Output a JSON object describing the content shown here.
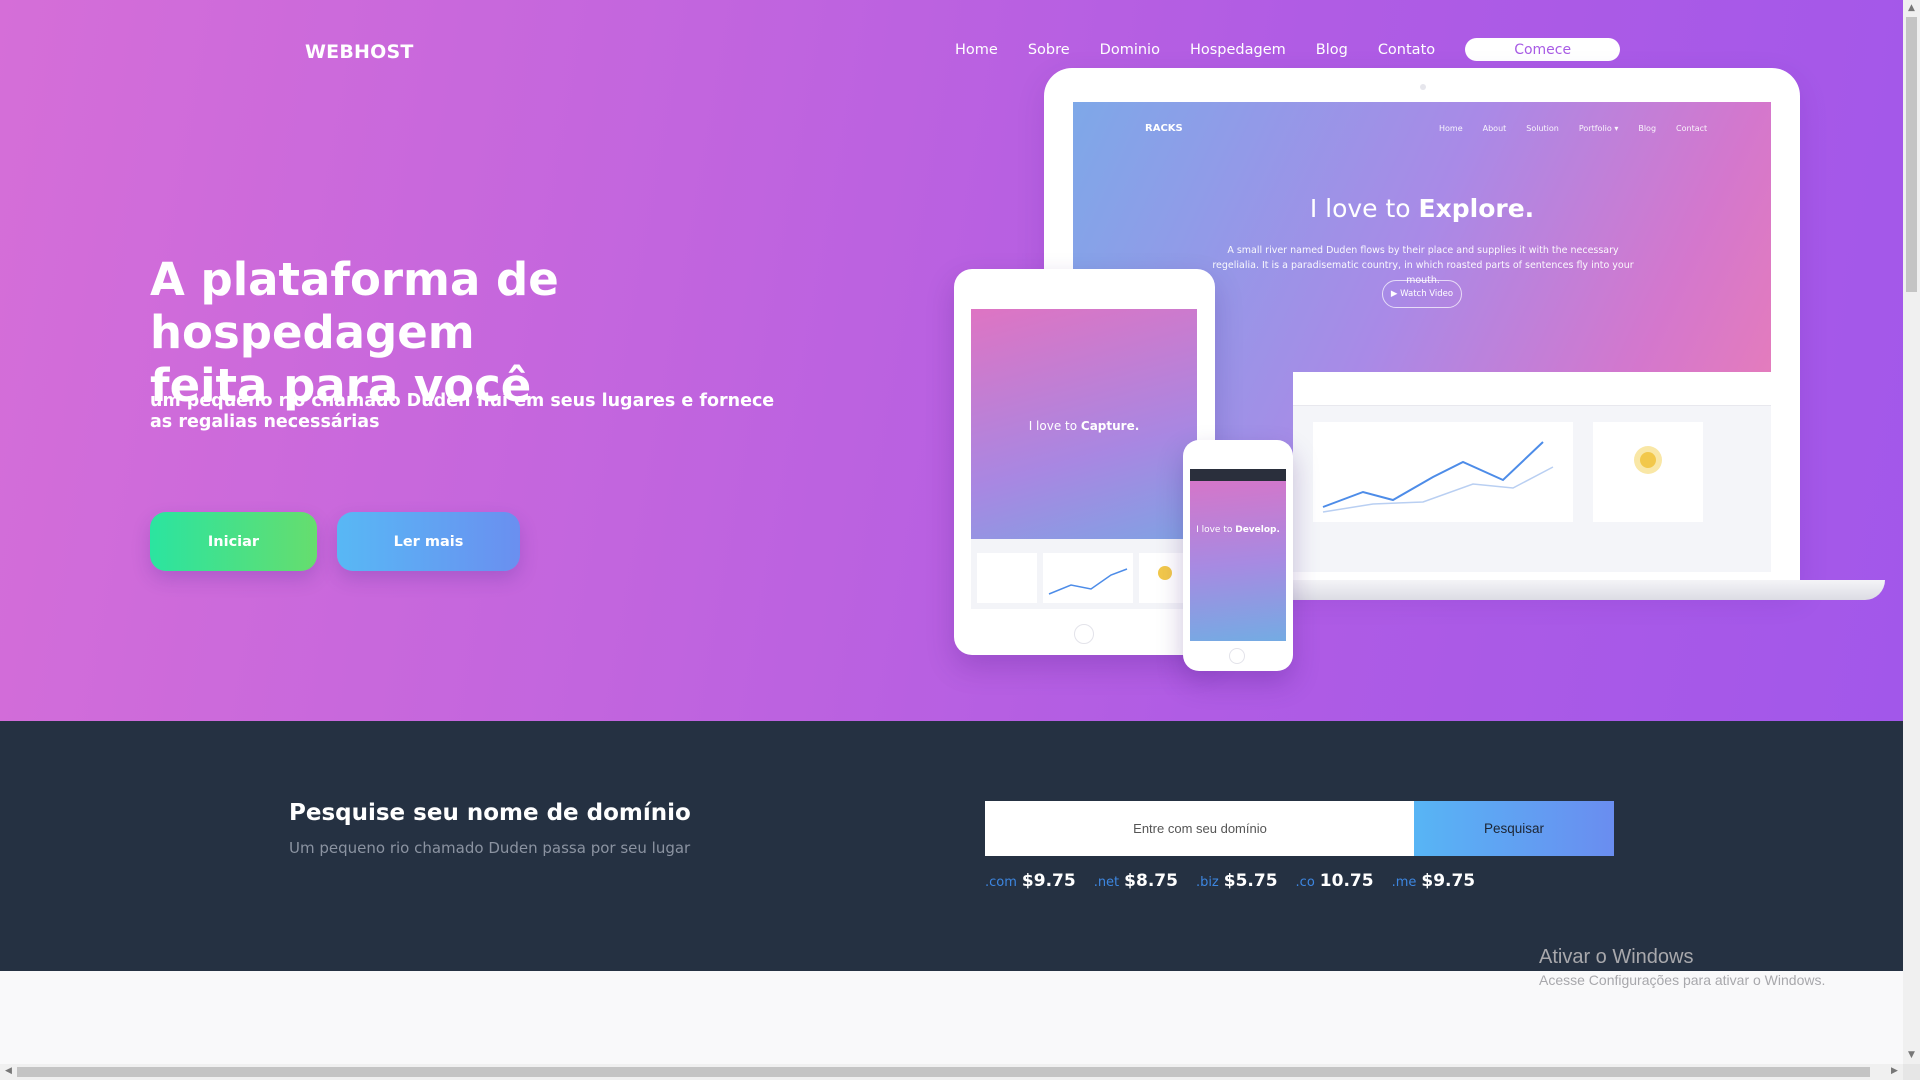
{
  "header": {
    "brand": "WEBHOST",
    "nav": [
      "Home",
      "Sobre",
      "Dominio",
      "Hospedagem",
      "Blog",
      "Contato"
    ],
    "cta": "Comece"
  },
  "hero": {
    "title_line1": "A plataforma de hospedagem",
    "title_line2": "feita para você",
    "subtitle": "um pequeno rio chamado Duden flui em seus lugares e fornece as regalias necessárias",
    "btn_start": "Iniciar",
    "btn_more": "Ler mais"
  },
  "mockup": {
    "laptop": {
      "brand": "RACKS",
      "nav": [
        "Home",
        "About",
        "Solution",
        "Portfolio ▾",
        "Blog",
        "Contact"
      ],
      "heading_pre": "I love to ",
      "heading_bold": "Explore.",
      "paragraph": "A small river named Duden flows by their place and supplies it with the necessary regelialia. It is a paradisematic country, in which roasted parts of sentences fly into your mouth.",
      "watch": "▶ Watch Video"
    },
    "tablet": {
      "heading_pre": "I love to ",
      "heading_bold": "Capture."
    },
    "phone": {
      "heading_pre": "I love to ",
      "heading_bold": "Develop."
    }
  },
  "domain_search": {
    "title": "Pesquise seu nome de domínio",
    "subtitle": "Um pequeno rio chamado Duden passa por seu lugar",
    "input_placeholder": "Entre com seu domínio",
    "button": "Pesquisar",
    "tlds": [
      {
        "ext": ".com",
        "price": "$9.75"
      },
      {
        "ext": ".net",
        "price": "$8.75"
      },
      {
        "ext": ".biz",
        "price": "$5.75"
      },
      {
        "ext": ".co",
        "price": "10.75"
      },
      {
        "ext": ".me",
        "price": "$9.75"
      }
    ]
  },
  "watermark": {
    "title": "Ativar o Windows",
    "subtitle": "Acesse Configurações para ativar o Windows."
  }
}
